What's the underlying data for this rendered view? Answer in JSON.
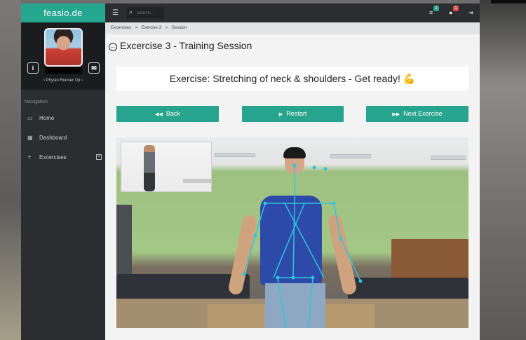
{
  "brand": "feasio.de",
  "profile": {
    "role": "Physio Runner Up",
    "info_icon": "info-icon",
    "mail_icon": "envelope-icon"
  },
  "sidebar": {
    "nav_title": "Navigation",
    "items": [
      {
        "label": "Home",
        "icon": "monitor-icon"
      },
      {
        "label": "Dashboard",
        "icon": "chart-icon"
      },
      {
        "label": "Excercises",
        "icon": "figure-icon",
        "expand": "plus-icon"
      }
    ]
  },
  "topbar": {
    "search_placeholder": "Search...",
    "tasks_badge": "2",
    "messages_badge": "1"
  },
  "breadcrumb": [
    "Excercises",
    "Exercise 3",
    "Session"
  ],
  "breadcrumb_sep": ">",
  "page_title": "Excercise 3 - Training Session",
  "exercise_banner": "Exercise: Stretching of neck & shoulders - Get ready! 💪",
  "buttons": {
    "back": "Back",
    "restart": "Restart",
    "next": "Next Exercise"
  },
  "colors": {
    "accent": "#27a48d",
    "sidebar": "#2b2d30",
    "badge_green": "#27a48d",
    "badge_red": "#d9534f",
    "skeleton": "#2ec4e0"
  }
}
